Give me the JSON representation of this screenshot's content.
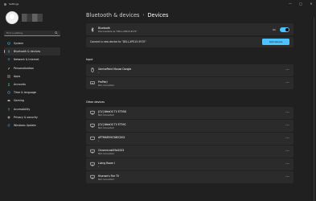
{
  "window": {
    "title": "Settings",
    "controls": [
      "—",
      "□",
      "✕"
    ]
  },
  "search": {
    "placeholder": "Find a setting"
  },
  "sidebar": {
    "items": [
      {
        "label": "System",
        "icon": "monitor-icon",
        "color": "#4cc2ff"
      },
      {
        "label": "Bluetooth & devices",
        "icon": "bluetooth-icon",
        "color": "#4cc2ff",
        "active": true
      },
      {
        "label": "Network & internet",
        "icon": "wifi-icon",
        "color": "#4cc2ff"
      },
      {
        "label": "Personalization",
        "icon": "brush-icon",
        "color": "#e8a33d"
      },
      {
        "label": "Apps",
        "icon": "apps-icon",
        "color": "#b5b5b5"
      },
      {
        "label": "Accounts",
        "icon": "account-icon",
        "color": "#5dbf6e"
      },
      {
        "label": "Time & language",
        "icon": "globe-clock-icon",
        "color": "#4cc2ff"
      },
      {
        "label": "Gaming",
        "icon": "gamepad-icon",
        "color": "#b5b5b5"
      },
      {
        "label": "Accessibility",
        "icon": "accessibility-icon",
        "color": "#4cc2ff"
      },
      {
        "label": "Privacy & security",
        "icon": "shield-icon",
        "color": "#8e8e8e"
      },
      {
        "label": "Windows Update",
        "icon": "update-icon",
        "color": "#4cc2ff"
      }
    ]
  },
  "header": {
    "breadcrumb_parent": "Bluetooth & devices",
    "separator": "›",
    "title": "Devices"
  },
  "bluetooth": {
    "title": "Bluetooth",
    "subtitle": "Discoverable as \"DELL-XPS15-9570\"",
    "toggle_label": "On",
    "toggle_on": true,
    "accent": "#4cc2ff"
  },
  "connect": {
    "text": "Connect a new device to \"DELL-XPS15-9570\"",
    "button_label": "Add device"
  },
  "sections": {
    "input": "Input",
    "other": "Other devices"
  },
  "input_devices": [
    {
      "name": "GenisePoint Mouse Dongle",
      "status": "•",
      "icon": "mouse-icon"
    },
    {
      "name": "ProPairJ",
      "status": "Not connected",
      "icon": "keyboard-icon"
    }
  ],
  "other_devices": [
    {
      "name": "[CV] WebOS TV ET59D",
      "status": "Not connected",
      "icon": "tv-icon"
    },
    {
      "name": "[CV] WebOS TV ET59C",
      "status": "Not connected",
      "icon": "tv-icon"
    },
    {
      "name": "APTMNR59C58ECD02",
      "status": "•",
      "icon": "device-icon"
    },
    {
      "name": "Chromecast59a2003",
      "status": "Not connected",
      "icon": "tv-icon"
    },
    {
      "name": "Living Room I",
      "status": "•",
      "icon": "tv-icon"
    },
    {
      "name": "Hisense's Fire TV",
      "status": "Not connected",
      "icon": "tv-icon"
    }
  ],
  "more_label": "···"
}
